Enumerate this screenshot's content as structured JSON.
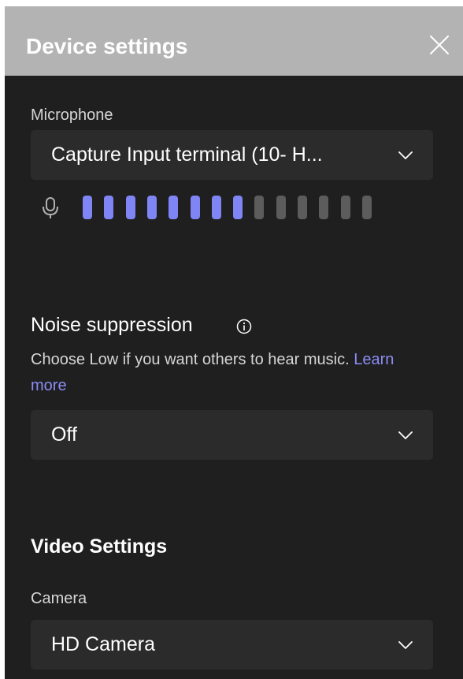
{
  "dialog": {
    "title": "Device settings",
    "close_icon": "close-icon"
  },
  "microphone": {
    "label": "Microphone",
    "selected": "Capture Input terminal (10- H...",
    "icon": "microphone-icon",
    "level_active_bars": 8,
    "level_total_bars": 14,
    "active_color": "#7f85f5",
    "inactive_color": "#5c5c5c"
  },
  "noise_suppression": {
    "heading": "Noise suppression",
    "info_icon": "info-icon",
    "description": "Choose Low if you want others to hear music.",
    "link_text": "Learn more",
    "selected": "Off"
  },
  "video": {
    "heading": "Video Settings",
    "camera_label": "Camera",
    "camera_selected": "HD Camera"
  },
  "colors": {
    "panel_background": "#1f1f1f",
    "header_background": "#b3b3b3",
    "dropdown_background": "#2b2b2b",
    "link": "#8b8cf4"
  }
}
